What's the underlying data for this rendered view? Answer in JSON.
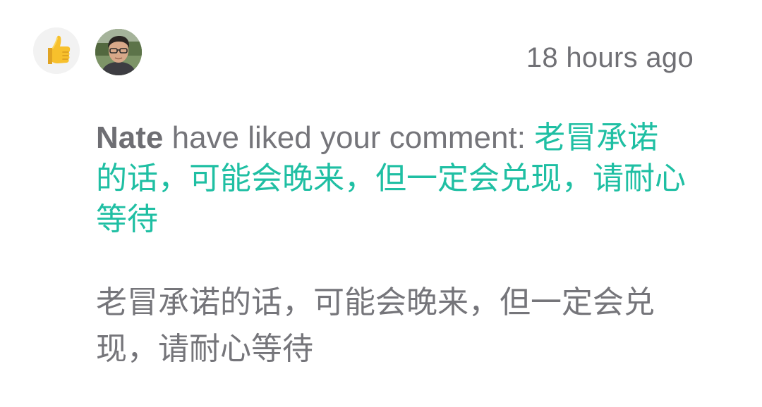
{
  "notification": {
    "icon": "thumbs-up-icon",
    "timestamp": "18 hours ago",
    "actor": "Nate",
    "action_text": " have liked your comment: ",
    "comment_link": "老冒承诺的话，可能会晚来，但一定会兑现，请耐心等待",
    "comment_body": "老冒承诺的话，可能会晚来，但一定会兑现，请耐心等待"
  },
  "colors": {
    "accent": "#1fbfa3",
    "text_gray": "#75757a",
    "badge_bg": "#f2f2f2",
    "thumb_yellow": "#f7c02c"
  }
}
